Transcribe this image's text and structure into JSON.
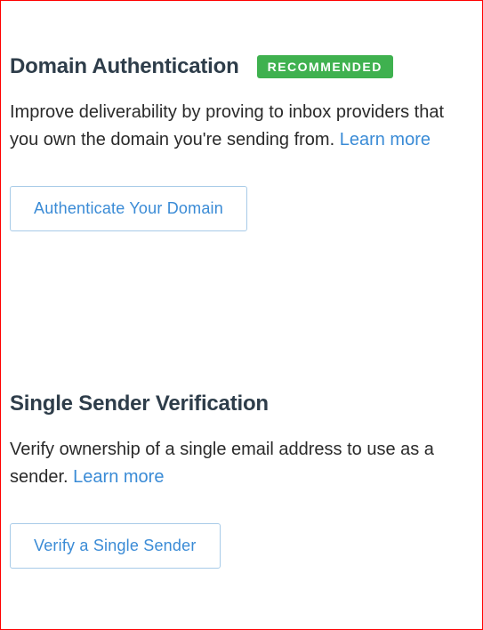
{
  "domain_auth": {
    "title": "Domain Authentication",
    "badge": "RECOMMENDED",
    "description_part1": "Improve deliverability by proving to inbox providers that you own the domain you're sending from. ",
    "learn_more": "Learn more",
    "button_label": "Authenticate Your Domain"
  },
  "single_sender": {
    "title": "Single Sender Verification",
    "description_part1": "Verify ownership of a single email address to use as a sender. ",
    "learn_more": "Learn more",
    "button_label": "Verify a Single Sender"
  }
}
